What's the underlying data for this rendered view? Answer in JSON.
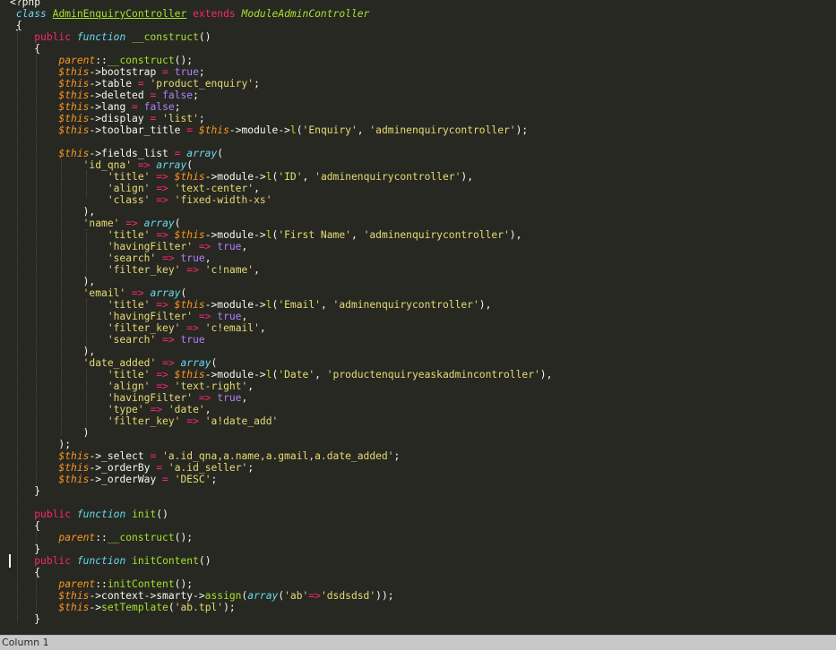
{
  "editor": {
    "colors": {
      "background": "#272822",
      "keyword": "#f92672",
      "storage": "#66d9ef",
      "class_name": "#a6e22e",
      "variable": "#fd971f",
      "string": "#e6db74",
      "constant": "#ae81ff",
      "text": "#f8f8f2"
    },
    "lines": [
      [
        [
          "pl",
          "<?php"
        ]
      ],
      [
        [
          "pl",
          " "
        ],
        [
          "st",
          "class"
        ],
        [
          "pl",
          " "
        ],
        [
          "cls",
          "AdminEnquiryController"
        ],
        [
          "pl",
          " "
        ],
        [
          "kw",
          "extends"
        ],
        [
          "pl",
          " "
        ],
        [
          "inh",
          "ModuleAdminController"
        ]
      ],
      [
        [
          "pl",
          " "
        ],
        [
          "brace",
          "{"
        ]
      ],
      [
        [
          "pl",
          "    "
        ],
        [
          "kw",
          "public"
        ],
        [
          "pl",
          " "
        ],
        [
          "st",
          "function"
        ],
        [
          "pl",
          " "
        ],
        [
          "fn",
          "__construct"
        ],
        [
          "pl",
          "()"
        ]
      ],
      [
        [
          "pl",
          "    {"
        ]
      ],
      [
        [
          "pl",
          "        "
        ],
        [
          "var",
          "parent"
        ],
        [
          "pl",
          "::"
        ],
        [
          "fn",
          "__construct"
        ],
        [
          "pl",
          "();"
        ]
      ],
      [
        [
          "pl",
          "        "
        ],
        [
          "var",
          "$this"
        ],
        [
          "pl",
          "->bootstrap "
        ],
        [
          "kw",
          "="
        ],
        [
          "pl",
          " "
        ],
        [
          "num",
          "true"
        ],
        [
          "pl",
          ";"
        ]
      ],
      [
        [
          "pl",
          "        "
        ],
        [
          "var",
          "$this"
        ],
        [
          "pl",
          "->table "
        ],
        [
          "kw",
          "="
        ],
        [
          "pl",
          " "
        ],
        [
          "str",
          "'product_enquiry'"
        ],
        [
          "pl",
          ";"
        ]
      ],
      [
        [
          "pl",
          "        "
        ],
        [
          "var",
          "$this"
        ],
        [
          "pl",
          "->deleted "
        ],
        [
          "kw",
          "="
        ],
        [
          "pl",
          " "
        ],
        [
          "num",
          "false"
        ],
        [
          "pl",
          ";"
        ]
      ],
      [
        [
          "pl",
          "        "
        ],
        [
          "var",
          "$this"
        ],
        [
          "pl",
          "->lang "
        ],
        [
          "kw",
          "="
        ],
        [
          "pl",
          " "
        ],
        [
          "num",
          "false"
        ],
        [
          "pl",
          ";"
        ]
      ],
      [
        [
          "pl",
          "        "
        ],
        [
          "var",
          "$this"
        ],
        [
          "pl",
          "->display "
        ],
        [
          "kw",
          "="
        ],
        [
          "pl",
          " "
        ],
        [
          "str",
          "'list'"
        ],
        [
          "pl",
          ";"
        ]
      ],
      [
        [
          "pl",
          "        "
        ],
        [
          "var",
          "$this"
        ],
        [
          "pl",
          "->toolbar_title "
        ],
        [
          "kw",
          "="
        ],
        [
          "pl",
          " "
        ],
        [
          "var",
          "$this"
        ],
        [
          "pl",
          "->module->"
        ],
        [
          "fn",
          "l"
        ],
        [
          "pl",
          "("
        ],
        [
          "str",
          "'Enquiry'"
        ],
        [
          "pl",
          ", "
        ],
        [
          "str",
          "'adminenquirycontroller'"
        ],
        [
          "pl",
          ");"
        ]
      ],
      [
        [
          "pl",
          ""
        ]
      ],
      [
        [
          "pl",
          "        "
        ],
        [
          "var",
          "$this"
        ],
        [
          "pl",
          "->fields_list "
        ],
        [
          "kw",
          "="
        ],
        [
          "pl",
          " "
        ],
        [
          "st",
          "array"
        ],
        [
          "pl",
          "("
        ]
      ],
      [
        [
          "pl",
          "            "
        ],
        [
          "str",
          "'id_qna'"
        ],
        [
          "pl",
          " "
        ],
        [
          "kw",
          "=>"
        ],
        [
          "pl",
          " "
        ],
        [
          "st",
          "array"
        ],
        [
          "pl",
          "("
        ]
      ],
      [
        [
          "pl",
          "                "
        ],
        [
          "str",
          "'title'"
        ],
        [
          "pl",
          " "
        ],
        [
          "kw",
          "=>"
        ],
        [
          "pl",
          " "
        ],
        [
          "var",
          "$this"
        ],
        [
          "pl",
          "->module->"
        ],
        [
          "fn",
          "l"
        ],
        [
          "pl",
          "("
        ],
        [
          "str",
          "'ID'"
        ],
        [
          "pl",
          ", "
        ],
        [
          "str",
          "'adminenquirycontroller'"
        ],
        [
          "pl",
          "),"
        ]
      ],
      [
        [
          "pl",
          "                "
        ],
        [
          "str",
          "'align'"
        ],
        [
          "pl",
          " "
        ],
        [
          "kw",
          "=>"
        ],
        [
          "pl",
          " "
        ],
        [
          "str",
          "'text-center'"
        ],
        [
          "pl",
          ","
        ]
      ],
      [
        [
          "pl",
          "                "
        ],
        [
          "str",
          "'class'"
        ],
        [
          "pl",
          " "
        ],
        [
          "kw",
          "=>"
        ],
        [
          "pl",
          " "
        ],
        [
          "str",
          "'fixed-width-xs'"
        ]
      ],
      [
        [
          "pl",
          "            ),"
        ]
      ],
      [
        [
          "pl",
          "            "
        ],
        [
          "str",
          "'name'"
        ],
        [
          "pl",
          " "
        ],
        [
          "kw",
          "=>"
        ],
        [
          "pl",
          " "
        ],
        [
          "st",
          "array"
        ],
        [
          "pl",
          "("
        ]
      ],
      [
        [
          "pl",
          "                "
        ],
        [
          "str",
          "'title'"
        ],
        [
          "pl",
          " "
        ],
        [
          "kw",
          "=>"
        ],
        [
          "pl",
          " "
        ],
        [
          "var",
          "$this"
        ],
        [
          "pl",
          "->module->"
        ],
        [
          "fn",
          "l"
        ],
        [
          "pl",
          "("
        ],
        [
          "str",
          "'First Name'"
        ],
        [
          "pl",
          ", "
        ],
        [
          "str",
          "'adminenquirycontroller'"
        ],
        [
          "pl",
          "),"
        ]
      ],
      [
        [
          "pl",
          "                "
        ],
        [
          "str",
          "'havingFilter'"
        ],
        [
          "pl",
          " "
        ],
        [
          "kw",
          "=>"
        ],
        [
          "pl",
          " "
        ],
        [
          "num",
          "true"
        ],
        [
          "pl",
          ","
        ]
      ],
      [
        [
          "pl",
          "                "
        ],
        [
          "str",
          "'search'"
        ],
        [
          "pl",
          " "
        ],
        [
          "kw",
          "=>"
        ],
        [
          "pl",
          " "
        ],
        [
          "num",
          "true"
        ],
        [
          "pl",
          ","
        ]
      ],
      [
        [
          "pl",
          "                "
        ],
        [
          "str",
          "'filter_key'"
        ],
        [
          "pl",
          " "
        ],
        [
          "kw",
          "=>"
        ],
        [
          "pl",
          " "
        ],
        [
          "str",
          "'c!name'"
        ],
        [
          "pl",
          ","
        ]
      ],
      [
        [
          "pl",
          "            ),"
        ]
      ],
      [
        [
          "pl",
          "            "
        ],
        [
          "str",
          "'email'"
        ],
        [
          "pl",
          " "
        ],
        [
          "kw",
          "=>"
        ],
        [
          "pl",
          " "
        ],
        [
          "st",
          "array"
        ],
        [
          "pl",
          "("
        ]
      ],
      [
        [
          "pl",
          "                "
        ],
        [
          "str",
          "'title'"
        ],
        [
          "pl",
          " "
        ],
        [
          "kw",
          "=>"
        ],
        [
          "pl",
          " "
        ],
        [
          "var",
          "$this"
        ],
        [
          "pl",
          "->module->"
        ],
        [
          "fn",
          "l"
        ],
        [
          "pl",
          "("
        ],
        [
          "str",
          "'Email'"
        ],
        [
          "pl",
          ", "
        ],
        [
          "str",
          "'adminenquirycontroller'"
        ],
        [
          "pl",
          "),"
        ]
      ],
      [
        [
          "pl",
          "                "
        ],
        [
          "str",
          "'havingFilter'"
        ],
        [
          "pl",
          " "
        ],
        [
          "kw",
          "=>"
        ],
        [
          "pl",
          " "
        ],
        [
          "num",
          "true"
        ],
        [
          "pl",
          ","
        ]
      ],
      [
        [
          "pl",
          "                "
        ],
        [
          "str",
          "'filter_key'"
        ],
        [
          "pl",
          " "
        ],
        [
          "kw",
          "=>"
        ],
        [
          "pl",
          " "
        ],
        [
          "str",
          "'c!email'"
        ],
        [
          "pl",
          ","
        ]
      ],
      [
        [
          "pl",
          "                "
        ],
        [
          "str",
          "'search'"
        ],
        [
          "pl",
          " "
        ],
        [
          "kw",
          "=>"
        ],
        [
          "pl",
          " "
        ],
        [
          "num",
          "true"
        ]
      ],
      [
        [
          "pl",
          "            ),"
        ]
      ],
      [
        [
          "pl",
          "            "
        ],
        [
          "str",
          "'date_added'"
        ],
        [
          "pl",
          " "
        ],
        [
          "kw",
          "=>"
        ],
        [
          "pl",
          " "
        ],
        [
          "st",
          "array"
        ],
        [
          "pl",
          "("
        ]
      ],
      [
        [
          "pl",
          "                "
        ],
        [
          "str",
          "'title'"
        ],
        [
          "pl",
          " "
        ],
        [
          "kw",
          "=>"
        ],
        [
          "pl",
          " "
        ],
        [
          "var",
          "$this"
        ],
        [
          "pl",
          "->module->"
        ],
        [
          "fn",
          "l"
        ],
        [
          "pl",
          "("
        ],
        [
          "str",
          "'Date'"
        ],
        [
          "pl",
          ", "
        ],
        [
          "str",
          "'productenquiryeaskadmincontroller'"
        ],
        [
          "pl",
          "),"
        ]
      ],
      [
        [
          "pl",
          "                "
        ],
        [
          "str",
          "'align'"
        ],
        [
          "pl",
          " "
        ],
        [
          "kw",
          "=>"
        ],
        [
          "pl",
          " "
        ],
        [
          "str",
          "'text-right'"
        ],
        [
          "pl",
          ","
        ]
      ],
      [
        [
          "pl",
          "                "
        ],
        [
          "str",
          "'havingFilter'"
        ],
        [
          "pl",
          " "
        ],
        [
          "kw",
          "=>"
        ],
        [
          "pl",
          " "
        ],
        [
          "num",
          "true"
        ],
        [
          "pl",
          ","
        ]
      ],
      [
        [
          "pl",
          "                "
        ],
        [
          "str",
          "'type'"
        ],
        [
          "pl",
          " "
        ],
        [
          "kw",
          "=>"
        ],
        [
          "pl",
          " "
        ],
        [
          "str",
          "'date'"
        ],
        [
          "pl",
          ","
        ]
      ],
      [
        [
          "pl",
          "                "
        ],
        [
          "str",
          "'filter_key'"
        ],
        [
          "pl",
          " "
        ],
        [
          "kw",
          "=>"
        ],
        [
          "pl",
          " "
        ],
        [
          "str",
          "'a!date_add'"
        ]
      ],
      [
        [
          "pl",
          "            )"
        ]
      ],
      [
        [
          "pl",
          "        );"
        ]
      ],
      [
        [
          "pl",
          "        "
        ],
        [
          "var",
          "$this"
        ],
        [
          "pl",
          "->_select "
        ],
        [
          "kw",
          "="
        ],
        [
          "pl",
          " "
        ],
        [
          "str",
          "'a.id_qna,a.name,a.gmail,a.date_added'"
        ],
        [
          "pl",
          ";"
        ]
      ],
      [
        [
          "pl",
          "        "
        ],
        [
          "var",
          "$this"
        ],
        [
          "pl",
          "->_orderBy "
        ],
        [
          "kw",
          "="
        ],
        [
          "pl",
          " "
        ],
        [
          "str",
          "'a.id_seller'"
        ],
        [
          "pl",
          ";"
        ]
      ],
      [
        [
          "pl",
          "        "
        ],
        [
          "var",
          "$this"
        ],
        [
          "pl",
          "->_orderWay "
        ],
        [
          "kw",
          "="
        ],
        [
          "pl",
          " "
        ],
        [
          "str",
          "'DESC'"
        ],
        [
          "pl",
          ";"
        ]
      ],
      [
        [
          "pl",
          "    }"
        ]
      ],
      [
        [
          "pl",
          ""
        ]
      ],
      [
        [
          "pl",
          "    "
        ],
        [
          "kw",
          "public"
        ],
        [
          "pl",
          " "
        ],
        [
          "st",
          "function"
        ],
        [
          "pl",
          " "
        ],
        [
          "fn",
          "init"
        ],
        [
          "pl",
          "()"
        ]
      ],
      [
        [
          "pl",
          "    {"
        ]
      ],
      [
        [
          "pl",
          "        "
        ],
        [
          "var",
          "parent"
        ],
        [
          "pl",
          "::"
        ],
        [
          "fn",
          "__construct"
        ],
        [
          "pl",
          "();"
        ]
      ],
      [
        [
          "pl",
          "    }"
        ]
      ],
      [
        [
          "pl",
          "    "
        ],
        [
          "kw",
          "public"
        ],
        [
          "pl",
          " "
        ],
        [
          "st",
          "function"
        ],
        [
          "pl",
          " "
        ],
        [
          "fn",
          "initContent"
        ],
        [
          "pl",
          "()"
        ]
      ],
      [
        [
          "pl",
          "    {"
        ]
      ],
      [
        [
          "pl",
          "        "
        ],
        [
          "var",
          "parent"
        ],
        [
          "pl",
          "::"
        ],
        [
          "fn",
          "initContent"
        ],
        [
          "pl",
          "();"
        ]
      ],
      [
        [
          "pl",
          "        "
        ],
        [
          "var",
          "$this"
        ],
        [
          "pl",
          "->context->smarty->"
        ],
        [
          "fn",
          "assign"
        ],
        [
          "pl",
          "("
        ],
        [
          "st",
          "array"
        ],
        [
          "pl",
          "("
        ],
        [
          "str",
          "'ab'"
        ],
        [
          "kw",
          "=>"
        ],
        [
          "str",
          "'dsdsdsd'"
        ],
        [
          "pl",
          "));"
        ]
      ],
      [
        [
          "pl",
          "        "
        ],
        [
          "var",
          "$this"
        ],
        [
          "pl",
          "->"
        ],
        [
          "fn",
          "setTemplate"
        ],
        [
          "pl",
          "("
        ],
        [
          "str",
          "'ab.tpl'"
        ],
        [
          "pl",
          ");"
        ]
      ],
      [
        [
          "pl",
          "    }"
        ]
      ]
    ]
  },
  "statusbar": {
    "text": "Column 1"
  }
}
